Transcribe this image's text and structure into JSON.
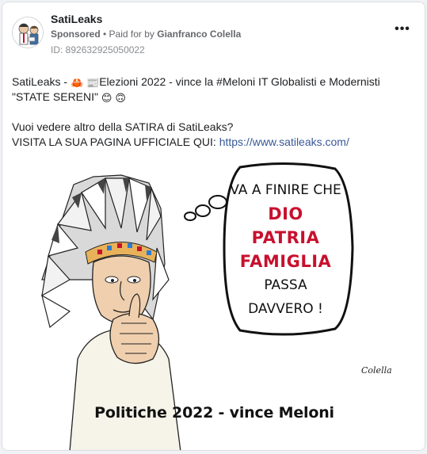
{
  "header": {
    "page_name": "SatiLeaks",
    "sponsored": "Sponsored",
    "paid_for_prefix": " • Paid for by ",
    "payer": "Gianfranco Colella",
    "ad_id": "ID: 892632925050022",
    "more_label": "•••"
  },
  "post": {
    "line1_prefix": "SatiLeaks - ",
    "line1_main": "Elezioni 2022 - vince la #Meloni IT Globalisti e Modernisti \"STATE SERENI\"",
    "line2": "Vuoi vedere altro della SATIRA di SatiLeaks?",
    "line3_prefix": "VISITA LA SUA PAGINA UFFICIALE QUI: ",
    "link": "https://www.satileaks.com/"
  },
  "cartoon": {
    "bubble_line1": "VA A FINIRE CHE",
    "bubble_red1": "DIO",
    "bubble_red2": "PATRIA",
    "bubble_red3": "FAMIGLIA",
    "bubble_line5": "PASSA",
    "bubble_line6": "DAVVERO !",
    "signature": "Colella",
    "caption": "Politiche 2022 - vince Meloni"
  },
  "colors": {
    "link": "#385898",
    "accent_red": "#c8102e",
    "meta_gray": "#65676b"
  },
  "icons": [
    "crab-emoji",
    "newspaper-emoji",
    "smiling-emoji",
    "upside-down-emoji",
    "more-options-icon"
  ]
}
